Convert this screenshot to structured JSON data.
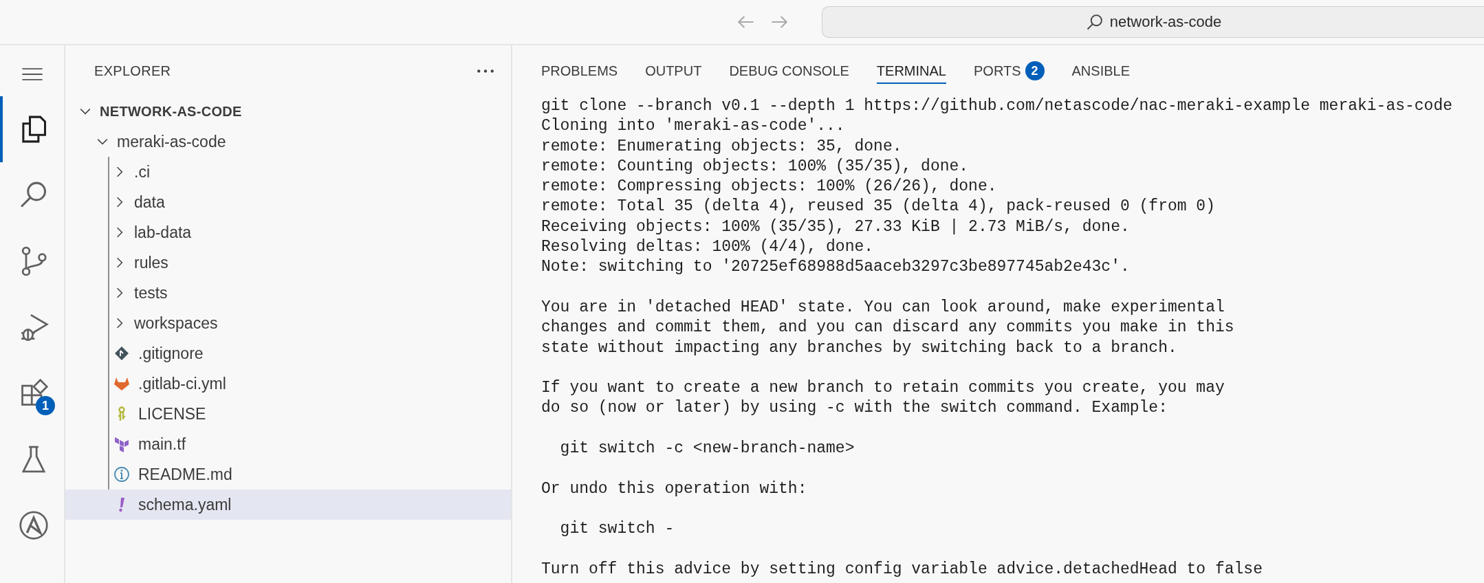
{
  "title_bar": {
    "search": {
      "value": "network-as-code"
    }
  },
  "activity_bar": {
    "items": [
      {
        "kind": "explorer",
        "selected": true
      },
      {
        "kind": "search",
        "selected": false
      },
      {
        "kind": "source-control",
        "selected": false
      },
      {
        "kind": "run-debug",
        "selected": false
      },
      {
        "kind": "extensions",
        "selected": false,
        "badge": "1"
      },
      {
        "kind": "testing",
        "selected": false
      },
      {
        "kind": "ansible",
        "selected": false
      }
    ]
  },
  "explorer": {
    "title": "EXPLORER",
    "tree": [
      {
        "label": "NETWORK-AS-CODE",
        "kind": "root",
        "expanded": true,
        "selected": false,
        "children": [
          {
            "label": "meraki-as-code",
            "kind": "folder",
            "expanded": true,
            "selected": false,
            "children": [
              {
                "label": ".ci",
                "kind": "folder",
                "expanded": false,
                "selected": false
              },
              {
                "label": "data",
                "kind": "folder",
                "expanded": false,
                "selected": false
              },
              {
                "label": "lab-data",
                "kind": "folder",
                "expanded": false,
                "selected": false
              },
              {
                "label": "rules",
                "kind": "folder",
                "expanded": false,
                "selected": false
              },
              {
                "label": "tests",
                "kind": "folder",
                "expanded": false,
                "selected": false
              },
              {
                "label": "workspaces",
                "kind": "folder",
                "expanded": false,
                "selected": false
              },
              {
                "label": ".gitignore",
                "kind": "git",
                "selected": false
              },
              {
                "label": ".gitlab-ci.yml",
                "kind": "gitlab",
                "selected": false
              },
              {
                "label": "LICENSE",
                "kind": "license",
                "selected": false
              },
              {
                "label": "main.tf",
                "kind": "terraform",
                "selected": false
              },
              {
                "label": "README.md",
                "kind": "info",
                "selected": false
              },
              {
                "label": "schema.yaml",
                "kind": "yaml",
                "selected": true
              }
            ]
          }
        ]
      }
    ]
  },
  "panel": {
    "tabs": [
      {
        "label": "PROBLEMS",
        "selected": false
      },
      {
        "label": "OUTPUT",
        "selected": false
      },
      {
        "label": "DEBUG CONSOLE",
        "selected": false
      },
      {
        "label": "TERMINAL",
        "selected": true
      },
      {
        "label": "PORTS",
        "selected": false,
        "badge": "2"
      },
      {
        "label": "ANSIBLE",
        "selected": false
      }
    ],
    "terminal": {
      "blocks": [
        {
          "lines": [
            "git clone --branch v0.1 --depth 1 https://github.com/netascode/nac-meraki-example meraki-as-code",
            "Cloning into 'meraki-as-code'...",
            "remote: Enumerating objects: 35, done.",
            "remote: Counting objects: 100% (35/35), done.",
            "remote: Compressing objects: 100% (26/26), done.",
            "remote: Total 35 (delta 4), reused 35 (delta 4), pack-reused 0 (from 0)",
            "Receiving objects: 100% (35/35), 27.33 KiB | 2.73 MiB/s, done.",
            "Resolving deltas: 100% (4/4), done.",
            "Note: switching to '20725ef68988d5aaceb3297c3be897745ab2e43c'."
          ]
        },
        {
          "lines": [
            "You are in 'detached HEAD' state. You can look around, make experimental",
            "changes and commit them, and you can discard any commits you make in this",
            "state without impacting any branches by switching back to a branch."
          ]
        },
        {
          "lines": [
            "If you want to create a new branch to retain commits you create, you may",
            "do so (now or later) by using -c with the switch command. Example:"
          ]
        },
        {
          "lines": [
            "  git switch -c <new-branch-name>"
          ]
        },
        {
          "lines": [
            "Or undo this operation with:"
          ]
        },
        {
          "lines": [
            "  git switch -"
          ]
        },
        {
          "lines": [
            "Turn off this advice by setting config variable advice.detachedHead to false"
          ]
        }
      ]
    }
  }
}
